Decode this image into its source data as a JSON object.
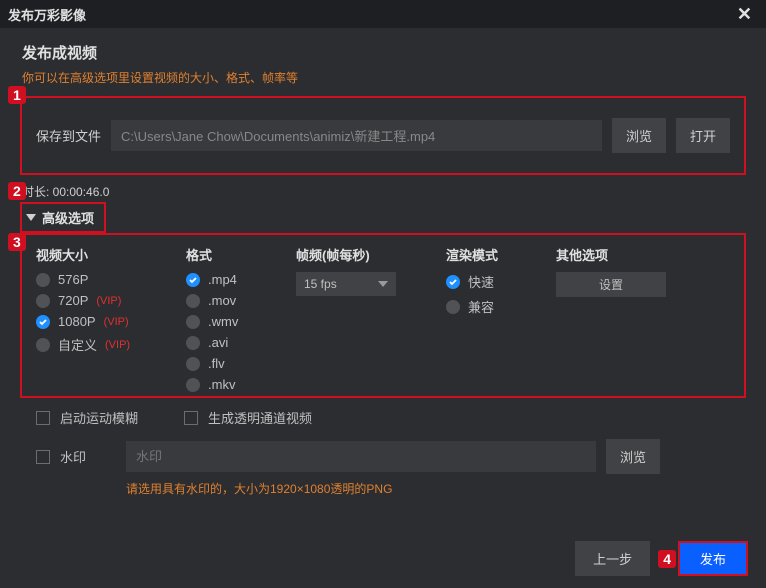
{
  "titlebar": {
    "title": "发布万彩影像"
  },
  "header": {
    "title": "发布成视频",
    "hint": "你可以在高级选项里设置视频的大小、格式、帧率等"
  },
  "file": {
    "label": "保存到文件",
    "path": "C:\\Users\\Jane Chow\\Documents\\animiz\\新建工程.mp4",
    "browse": "浏览",
    "open": "打开"
  },
  "duration": {
    "label": "时长: 00:00:46.0"
  },
  "advanced": {
    "label": "高级选项"
  },
  "badges": {
    "b1": "1",
    "b2": "2",
    "b3": "3",
    "b4": "4"
  },
  "cols": {
    "size": {
      "title": "视频大小",
      "items": [
        "576P",
        "720P",
        "1080P",
        "自定义"
      ],
      "vip": "(VIP)"
    },
    "fmt": {
      "title": "格式",
      "items": [
        ".mp4",
        ".mov",
        ".wmv",
        ".avi",
        ".flv",
        ".mkv"
      ]
    },
    "fps": {
      "title": "帧频(帧每秒)",
      "value": "15 fps"
    },
    "render": {
      "title": "渲染模式",
      "items": [
        "快速",
        "兼容"
      ]
    },
    "other": {
      "title": "其他选项",
      "btn": "设置"
    }
  },
  "checks": {
    "motion": "启动运动模糊",
    "alpha": "生成透明通道视频"
  },
  "watermark": {
    "label": "水印",
    "placeholder": "水印",
    "browse": "浏览",
    "hint": "请选用具有水印的，大小为1920×1080透明的PNG"
  },
  "footer": {
    "prev": "上一步",
    "publish": "发布"
  }
}
